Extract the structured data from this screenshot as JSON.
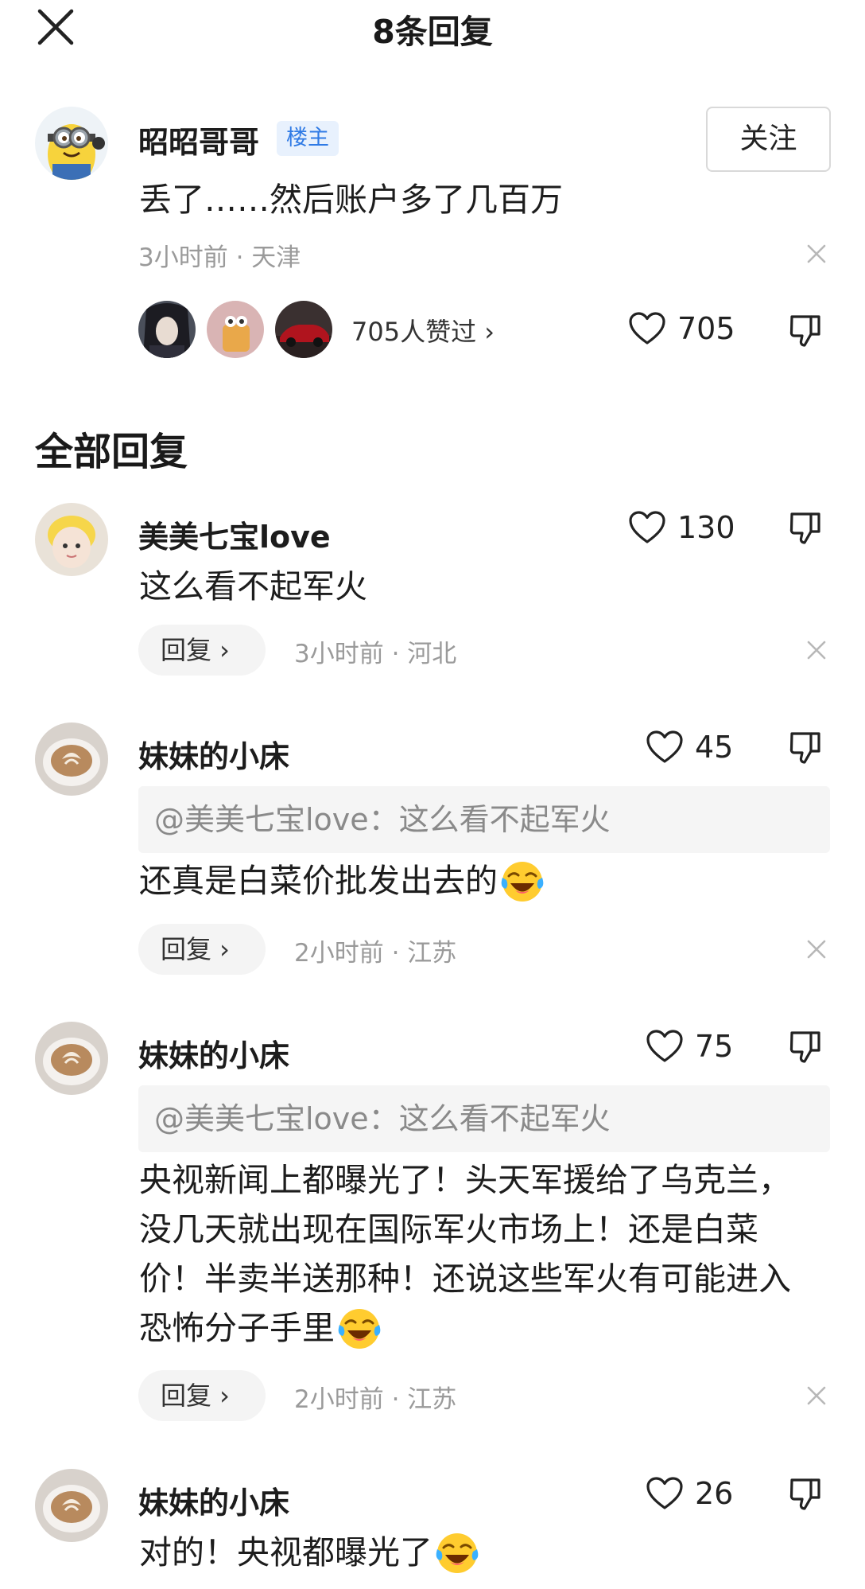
{
  "header": {
    "title": "8条回复"
  },
  "post": {
    "username": "昭昭哥哥",
    "badge": "楼主",
    "follow_label": "关注",
    "content": "丢了……然后账户多了几百万",
    "meta": "3小时前 · 天津",
    "liked_text": "705人赞过 ›",
    "likes": "705",
    "colors": {
      "badge_bg": "#e8f1fd",
      "badge_text": "#2f7ae5"
    }
  },
  "section_title": "全部回复",
  "replies": [
    {
      "username": "美美七宝love",
      "likes": "130",
      "content": "这么看不起军火",
      "reply_label": "回复 ›",
      "meta": "3小时前 · 河北"
    },
    {
      "username": "妹妹的小床",
      "likes": "45",
      "quote": "@美美七宝love：这么看不起军火",
      "content": "还真是白菜价批发出去的",
      "reply_label": "回复 ›",
      "meta": "2小时前 · 江苏"
    },
    {
      "username": "妹妹的小床",
      "likes": "75",
      "quote": "@美美七宝love：这么看不起军火",
      "content": "央视新闻上都曝光了！头天军援给了乌克兰，没几天就出现在国际军火市场上！还是白菜价！半卖半送那种！还说这些军火有可能进入恐怖分子手里",
      "reply_label": "回复 ›",
      "meta": "2小时前 · 江苏"
    },
    {
      "username": "妹妹的小床",
      "likes": "26",
      "content": "对的！央视都曝光了"
    }
  ]
}
